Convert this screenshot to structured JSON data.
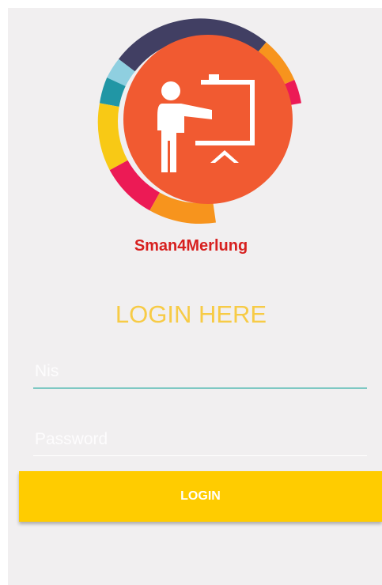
{
  "app": {
    "name": "Sman4Merlung"
  },
  "login": {
    "heading": "LOGIN HERE",
    "nis_placeholder": "Nis",
    "password_placeholder": "Password",
    "button_label": "LOGIN"
  },
  "logo": {
    "icon": "teacher-presentation-icon",
    "colors": {
      "center": "#f15a31",
      "navy": "#413f63",
      "orange": "#f7941d",
      "magenta": "#ec1a55",
      "yellow": "#f8c915",
      "teal": "#2196a5",
      "light_blue": "#8fcfe0"
    }
  },
  "colors": {
    "background": "#f1eff0",
    "title": "#d7201f",
    "heading": "#f7cb46",
    "button": "#ffcc00",
    "underline": "#7ec8c3"
  }
}
